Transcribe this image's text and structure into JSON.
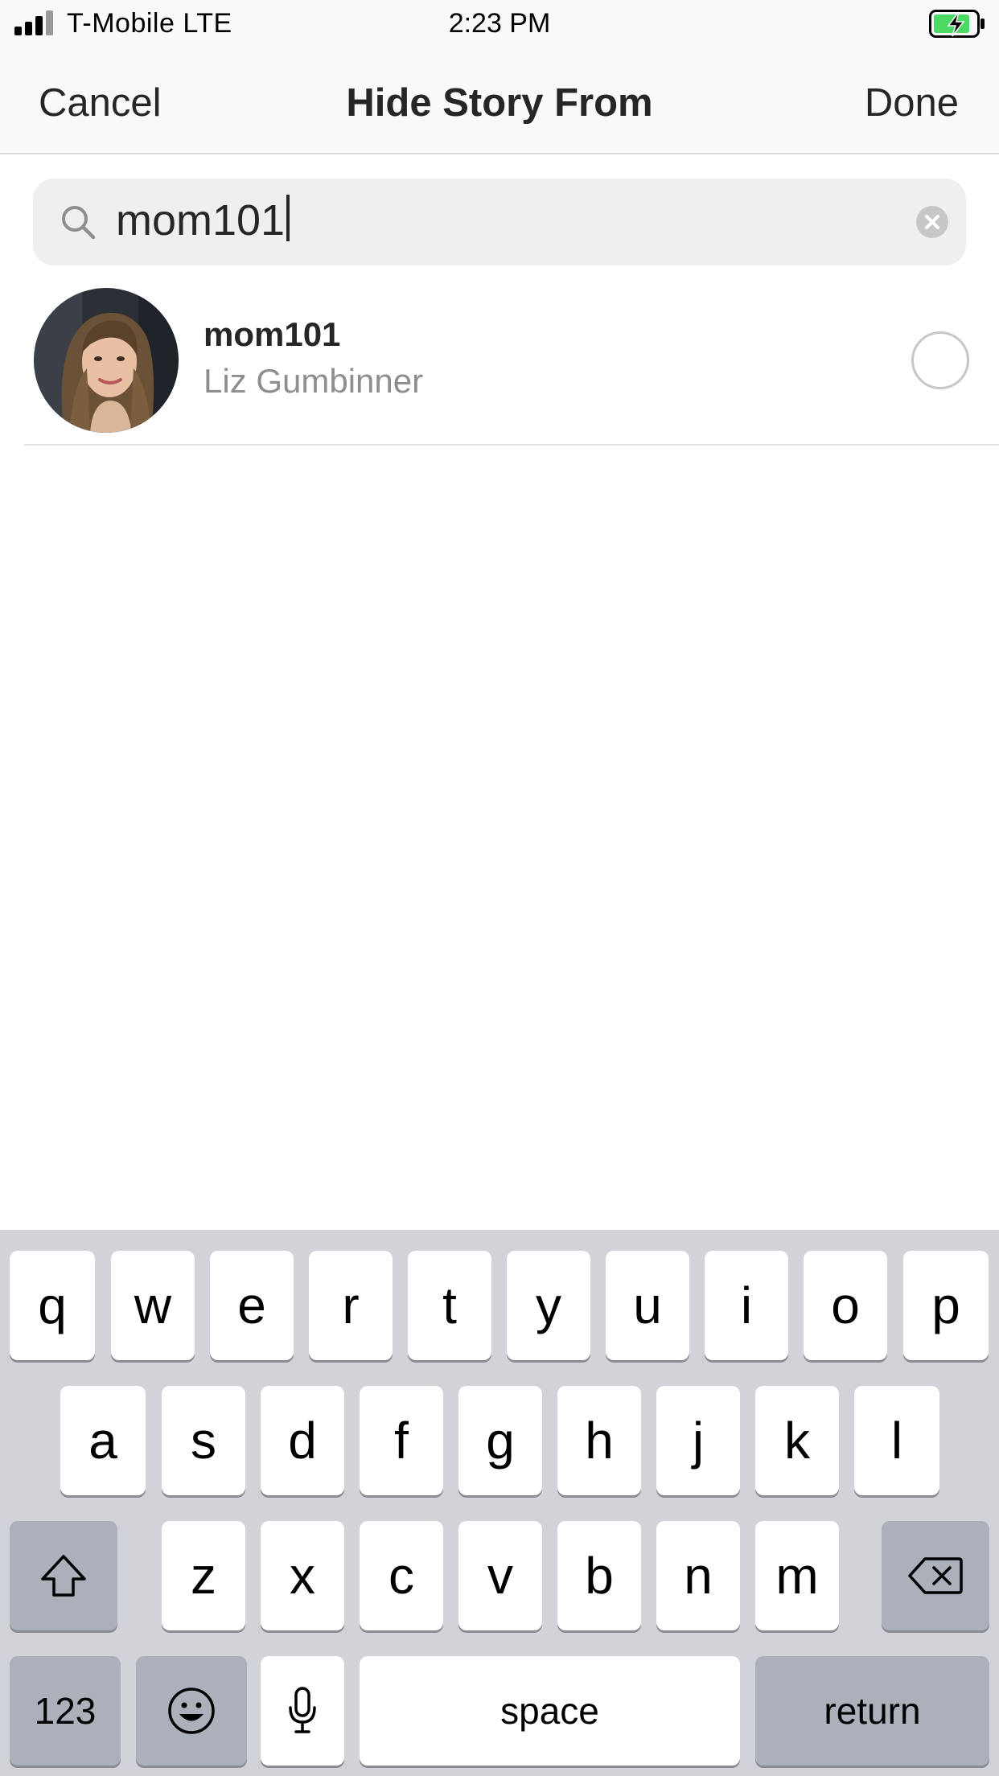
{
  "status_bar": {
    "carrier": "T-Mobile LTE",
    "time": "2:23 PM"
  },
  "nav": {
    "cancel_label": "Cancel",
    "title": "Hide Story From",
    "done_label": "Done"
  },
  "search": {
    "value": "mom101",
    "icon": "search-icon",
    "clear_icon": "clear-icon"
  },
  "results": [
    {
      "username": "mom101",
      "full_name": "Liz Gumbinner",
      "selected": false
    }
  ],
  "keyboard": {
    "row1": [
      "q",
      "w",
      "e",
      "r",
      "t",
      "y",
      "u",
      "i",
      "o",
      "p"
    ],
    "row2": [
      "a",
      "s",
      "d",
      "f",
      "g",
      "h",
      "j",
      "k",
      "l"
    ],
    "row3": [
      "z",
      "x",
      "c",
      "v",
      "b",
      "n",
      "m"
    ],
    "numbers_label": "123",
    "space_label": "space",
    "return_label": "return"
  },
  "colors": {
    "bar_background": "#f9f9f9",
    "text_primary": "#262626",
    "text_secondary": "#8e8e8e",
    "keyboard_background": "#d1d3d9",
    "battery_green": "#4cd964"
  }
}
